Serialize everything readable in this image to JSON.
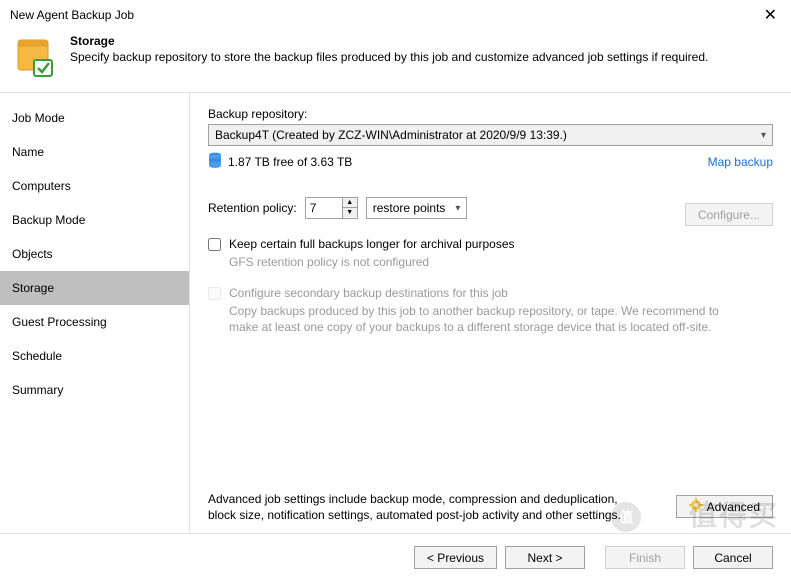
{
  "window": {
    "title": "New Agent Backup Job",
    "close": "✕"
  },
  "header": {
    "title": "Storage",
    "desc": "Specify backup repository to store the backup files produced by this job and customize advanced job settings if required."
  },
  "sidebar": {
    "items": [
      {
        "label": "Job Mode"
      },
      {
        "label": "Name"
      },
      {
        "label": "Computers"
      },
      {
        "label": "Backup Mode"
      },
      {
        "label": "Objects"
      },
      {
        "label": "Storage",
        "active": true
      },
      {
        "label": "Guest Processing"
      },
      {
        "label": "Schedule"
      },
      {
        "label": "Summary"
      }
    ]
  },
  "storage": {
    "repo_label": "Backup repository:",
    "repo_value": "Backup4T (Created by ZCZ-WIN\\Administrator at 2020/9/9 13:39.)",
    "free_text": "1.87 TB free of 3.63 TB",
    "map_backup": "Map backup",
    "retention_label": "Retention policy:",
    "retention_value": "7",
    "retention_unit": "restore points",
    "keep_full_label": "Keep certain full backups longer for archival purposes",
    "gfs_note": "GFS retention policy is not configured",
    "secondary_label": "Configure secondary backup destinations for this job",
    "secondary_note": "Copy backups produced by this job to another backup repository, or tape. We recommend to make at least one copy of your backups to a different storage device that is located off-site.",
    "configure_btn": "Configure...",
    "adv_text": "Advanced job settings include backup mode, compression and deduplication, block size, notification settings, automated post-job activity and other settings.",
    "adv_btn": "Advanced"
  },
  "footer": {
    "prev": "< Previous",
    "next": "Next >",
    "finish": "Finish",
    "cancel": "Cancel"
  }
}
